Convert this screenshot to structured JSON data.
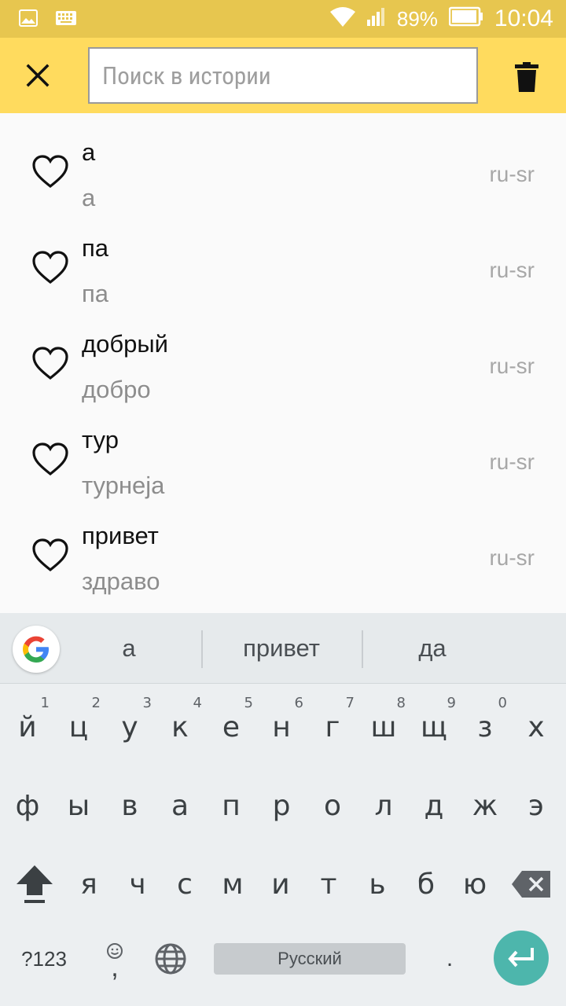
{
  "status_bar": {
    "battery": "89%",
    "time": "10:04",
    "icons": [
      "image-icon",
      "keyboard-icon",
      "wifi-icon",
      "signal-icon",
      "battery-icon"
    ]
  },
  "toolbar": {
    "search_placeholder": "Поиск в истории",
    "search_value": "",
    "background": "#ffdb5e",
    "icons": [
      "close-icon",
      "trash-icon"
    ]
  },
  "history": {
    "items": [
      {
        "word": "а",
        "translation": "а",
        "lang": "ru-sr"
      },
      {
        "word": "па",
        "translation": "па",
        "lang": "ru-sr"
      },
      {
        "word": "добрый",
        "translation": "добро",
        "lang": "ru-sr"
      },
      {
        "word": "тур",
        "translation": "турнеја",
        "lang": "ru-sr"
      },
      {
        "word": "привет",
        "translation": "здраво",
        "lang": "ru-sr"
      }
    ]
  },
  "keyboard": {
    "suggestions": [
      "а",
      "привет",
      "да"
    ],
    "row1": [
      {
        "char": "й",
        "hint": "1"
      },
      {
        "char": "ц",
        "hint": "2"
      },
      {
        "char": "у",
        "hint": "3"
      },
      {
        "char": "к",
        "hint": "4"
      },
      {
        "char": "е",
        "hint": "5"
      },
      {
        "char": "н",
        "hint": "6"
      },
      {
        "char": "г",
        "hint": "7"
      },
      {
        "char": "ш",
        "hint": "8"
      },
      {
        "char": "щ",
        "hint": "9"
      },
      {
        "char": "з",
        "hint": "0"
      },
      {
        "char": "х",
        "hint": ""
      }
    ],
    "row2": [
      "ф",
      "ы",
      "в",
      "а",
      "п",
      "р",
      "о",
      "л",
      "д",
      "ж",
      "э"
    ],
    "row3": [
      "я",
      "ч",
      "с",
      "м",
      "и",
      "т",
      "ь",
      "б",
      "ю"
    ],
    "symbols_label": "?123",
    "comma_label": ",",
    "space_label": "Русский",
    "period_label": ".",
    "accent": "#4db6ac"
  }
}
